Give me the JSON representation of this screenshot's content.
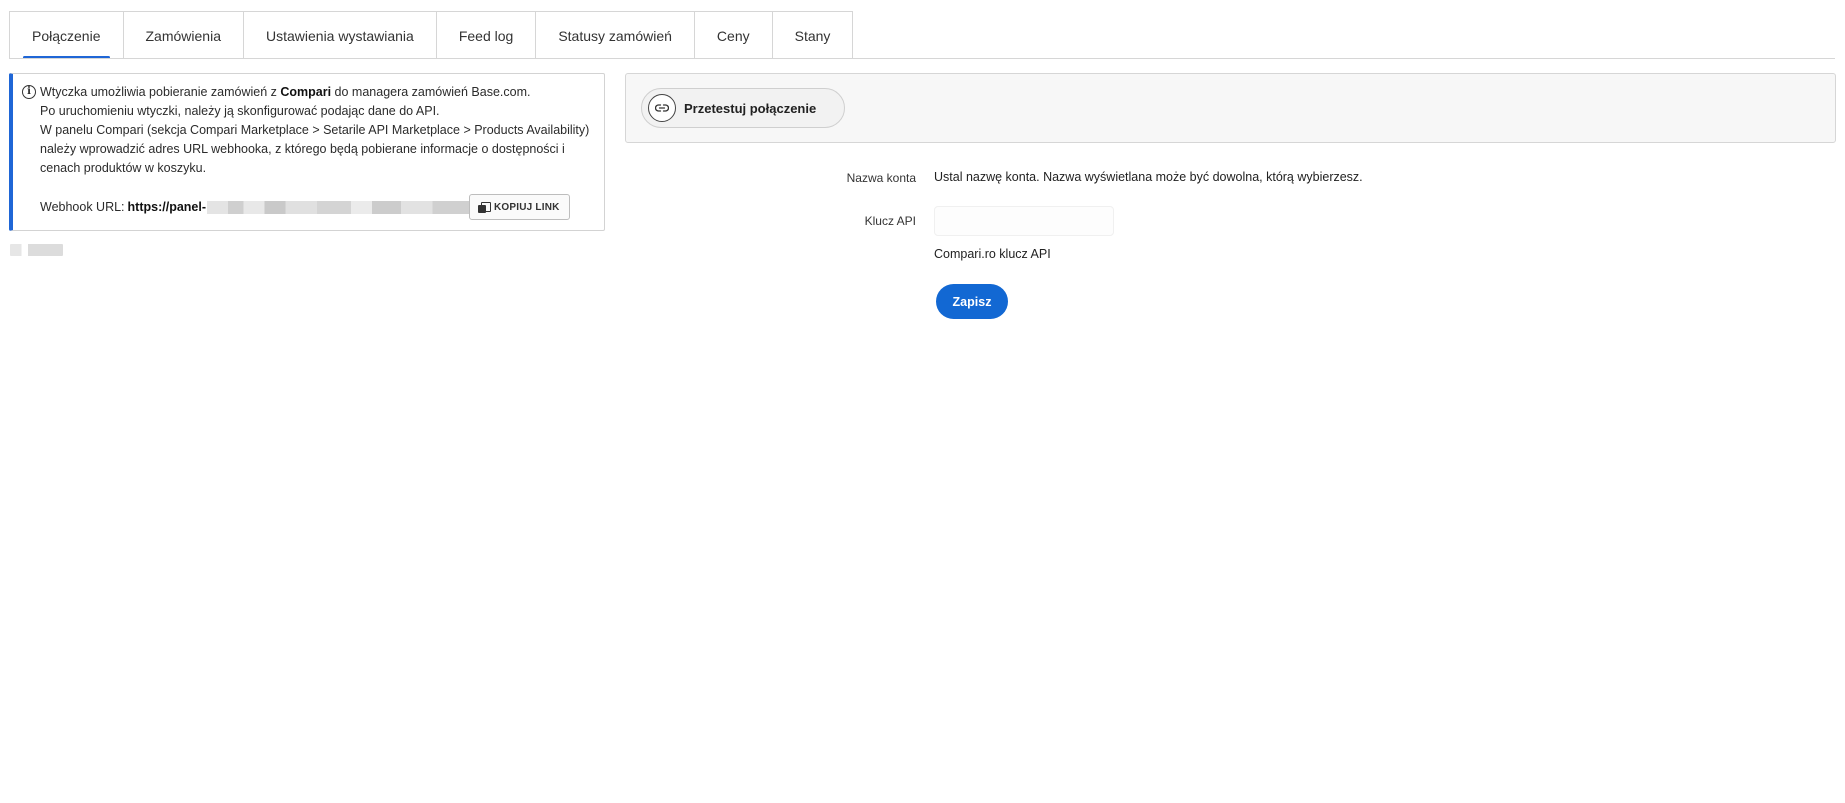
{
  "tabs": [
    {
      "label": "Połączenie",
      "active": true
    },
    {
      "label": "Zamówienia"
    },
    {
      "label": "Ustawienia wystawiania"
    },
    {
      "label": "Feed log"
    },
    {
      "label": "Statusy zamówień"
    },
    {
      "label": "Ceny"
    },
    {
      "label": "Stany"
    }
  ],
  "info": {
    "line1_before": "Wtyczka umożliwia pobieranie zamówień z ",
    "line1_bold": "Compari",
    "line1_after": " do managera zamówień Base.com.",
    "line2": "Po uruchomieniu wtyczki, należy ją skonfigurować podając dane do API.",
    "line3": "W panelu Compari (sekcja Compari Marketplace > Setarile API Marketplace > Products Availability) należy wprowadzić adres URL webhooka, z którego będą pobierane informacje o dostępności i cenach produktów w koszyku.",
    "webhook_label": "Webhook URL:",
    "webhook_url_visible": "https://panel-",
    "copy_label": "KOPIUJ LINK"
  },
  "test_connection": {
    "label": "Przetestuj połączenie"
  },
  "form": {
    "account_name_label": "Nazwa konta",
    "account_name_value": "Ustal nazwę konta. Nazwa wyświetlana może być dowolna, którą wybierzesz.",
    "api_key_label": "Klucz API",
    "api_key_value": "",
    "api_key_hint": "Compari.ro klucz API",
    "save_label": "Zapisz"
  },
  "colors": {
    "accent": "#1f66d6",
    "save_button": "#1268d3"
  }
}
